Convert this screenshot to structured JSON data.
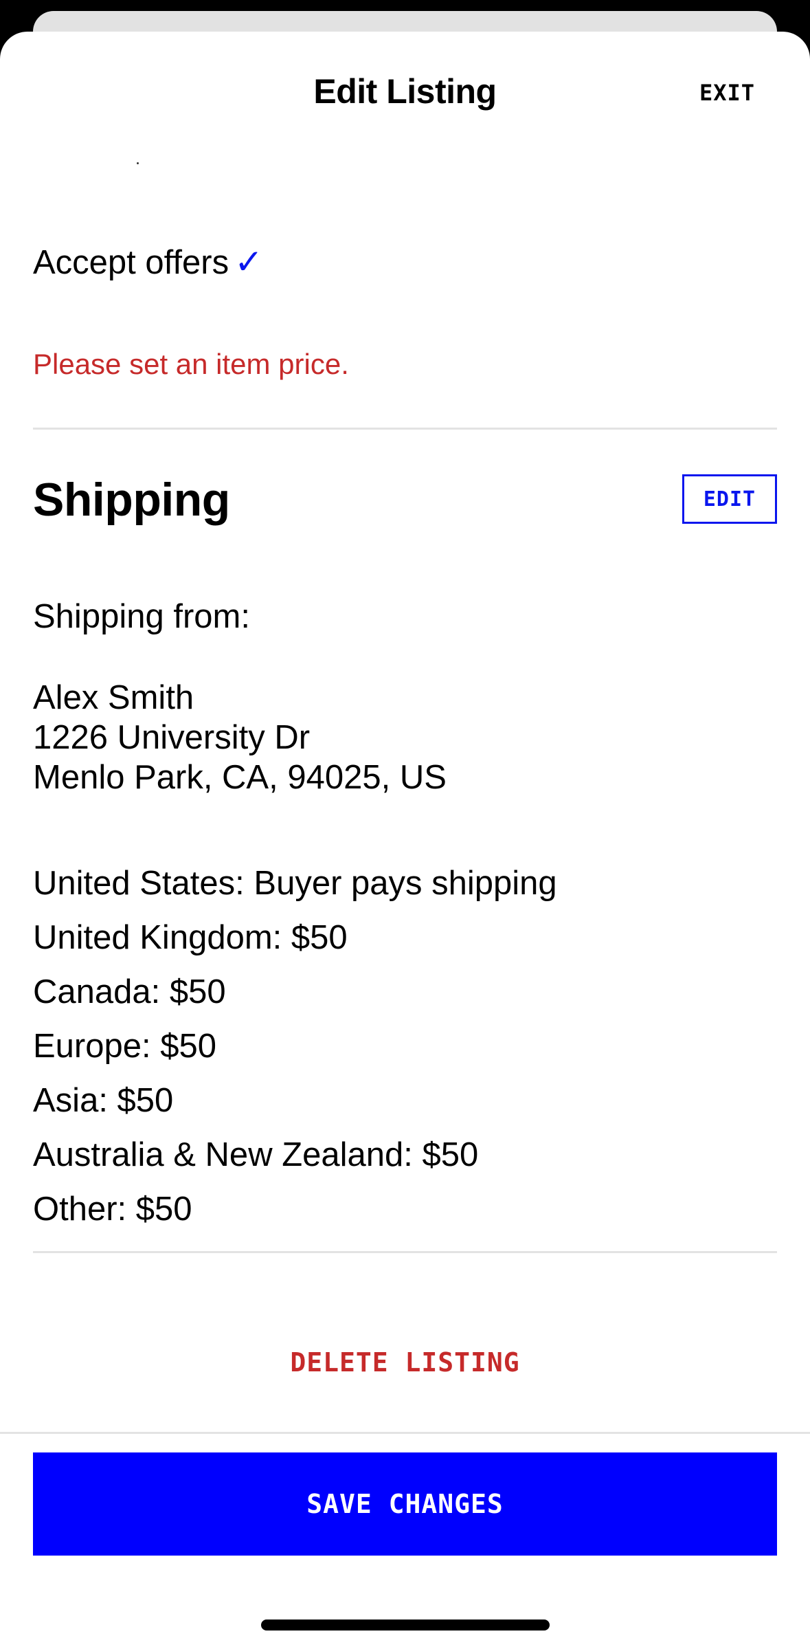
{
  "header": {
    "title": "Edit Listing",
    "exit_label": "EXIT"
  },
  "pricing": {
    "accept_offers_label": "Accept offers",
    "accept_offers_checked": true,
    "check_glyph": "✓",
    "error_message": "Please set an item price."
  },
  "shipping": {
    "heading": "Shipping",
    "edit_label": "EDIT",
    "from_label": "Shipping from:",
    "address": {
      "name": "Alex Smith",
      "street": "1226 University Dr",
      "city_line": "Menlo Park, CA, 94025, US"
    },
    "rates": [
      "United States: Buyer pays shipping",
      "United Kingdom: $50",
      "Canada: $50",
      "Europe: $50",
      "Asia: $50",
      "Australia & New Zealand: $50",
      "Other: $50"
    ]
  },
  "actions": {
    "delete_label": "DELETE LISTING",
    "save_label": "SAVE CHANGES"
  },
  "colors": {
    "accent_blue": "#0000fe",
    "error_red": "#c62a2a",
    "divider": "#e3e3e3"
  }
}
